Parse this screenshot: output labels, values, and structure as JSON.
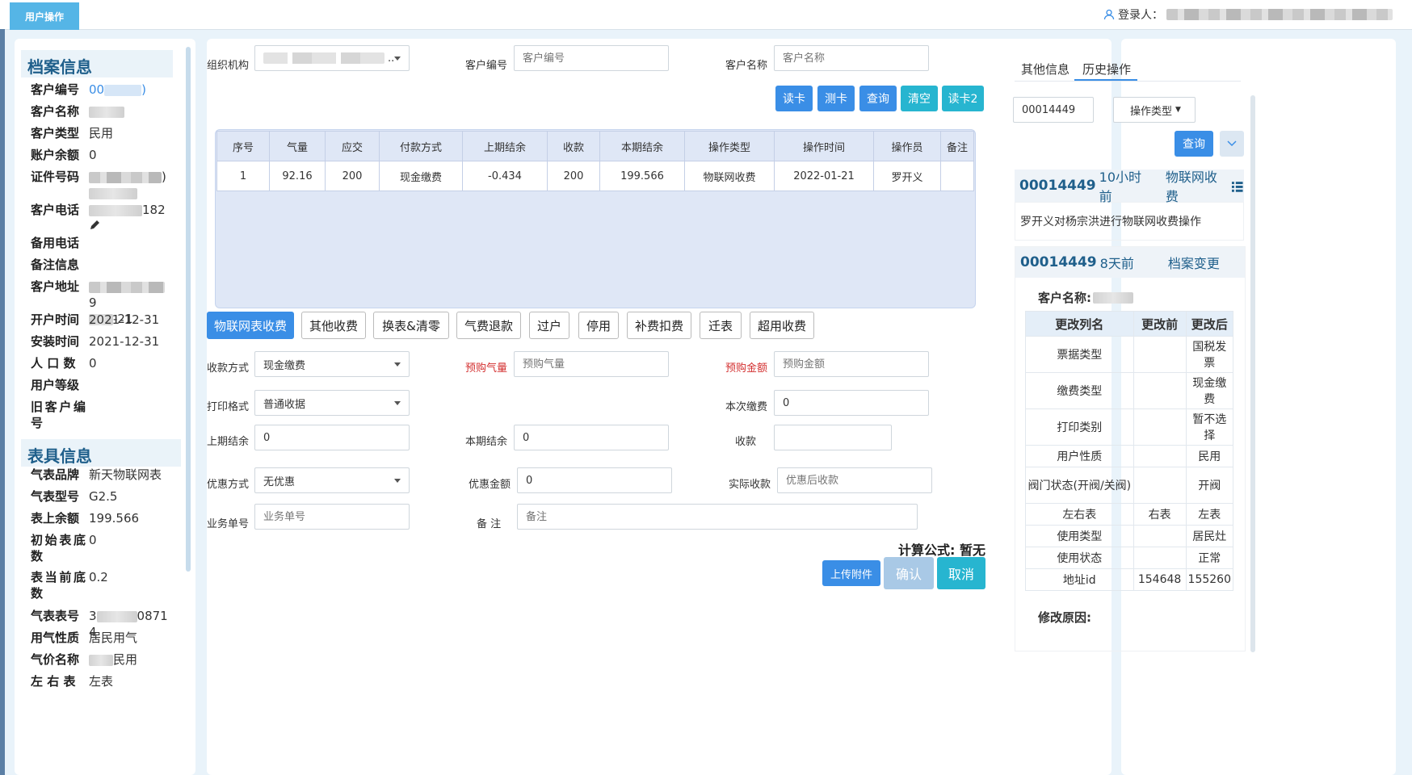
{
  "header": {
    "tab_label": "用户操作",
    "login_label": "登录人："
  },
  "archive": {
    "title": "档案信息",
    "customer_no_label": "客户编号",
    "customer_no_prefix": "00",
    "customer_no_suffix": ")",
    "customer_name_label": "客户名称",
    "customer_type_label": "客户类型",
    "customer_type": "民用",
    "balance_label": "账户余额",
    "balance": "0",
    "id_label": "证件号码",
    "id_suffix": ")",
    "phone_label": "客户电话",
    "phone_suffix": "182",
    "backup_phone_label": "备用电话",
    "remark_label": "备注信息",
    "address_label": "客户地址",
    "address_suffix": "9",
    "address_line2_suffix": "-21",
    "open_time_label": "开户时间",
    "open_time": "2021-12-31",
    "install_time_label": "安装时间",
    "install_time": "2021-12-31",
    "population_label": "人 口 数",
    "population": "0",
    "level_label": "用户等级",
    "old_no_label": "旧客户编号"
  },
  "meter": {
    "title": "表具信息",
    "brand_label": "气表品牌",
    "brand": "新天物联网表",
    "model_label": "气表型号",
    "model": "G2.5",
    "meter_balance_label": "表上余额",
    "meter_balance": "199.566",
    "init_reading_label": "初始表底数",
    "init_reading": "0",
    "current_reading_label": "表当前底数",
    "current_reading": "0.2",
    "meter_no_label": "气表表号",
    "meter_no_prefix": "3",
    "meter_no_suffix": "08714",
    "gas_nature_label": "用气性质",
    "gas_nature": "居民用气",
    "price_label": "气价名称",
    "price_suffix": "民用",
    "lr_label": "左 右 表",
    "lr": "左表"
  },
  "search": {
    "org_label": "组织机构",
    "cust_no_label": "客户编号",
    "cust_no_placeholder": "客户编号",
    "cust_name_label": "客户名称",
    "cust_name_placeholder": "客户名称",
    "buttons": [
      "读卡",
      "测卡",
      "查询",
      "清空",
      "读卡2"
    ]
  },
  "records": {
    "headers": [
      "序号",
      "气量",
      "应交",
      "付款方式",
      "上期结余",
      "收款",
      "本期结余",
      "操作类型",
      "操作时间",
      "操作员",
      "备注"
    ],
    "rows": [
      [
        "1",
        "92.16",
        "200",
        "现金缴费",
        "-0.434",
        "200",
        "199.566",
        "物联网收费",
        "2022-01-21",
        "罗开义",
        ""
      ]
    ]
  },
  "op_tabs": [
    "物联网表收费",
    "其他收费",
    "换表&清零",
    "气费退款",
    "过户",
    "停用",
    "补费扣费",
    "迁表",
    "超用收费"
  ],
  "form": {
    "pay_method_label": "收款方式",
    "pay_method": "现金缴费",
    "pre_gas_label": "预购气量",
    "pre_gas_placeholder": "预购气量",
    "pre_amount_label": "预购金额",
    "pre_amount_placeholder": "预购金额",
    "print_label": "打印格式",
    "print": "普通收据",
    "this_pay_label": "本次缴费",
    "this_pay": "0",
    "last_balance_label": "上期结余",
    "last_balance": "0",
    "cur_balance_label": "本期结余",
    "cur_balance": "0",
    "collect_label": "收款",
    "discount_label": "优惠方式",
    "discount": "无优惠",
    "discount_amount_label": "优惠金额",
    "discount_amount": "0",
    "actual_label": "实际收款",
    "actual_placeholder": "优惠后收款",
    "bizno_label": "业务单号",
    "bizno_placeholder": "业务单号",
    "note_label": "备 注",
    "note_placeholder": "备注",
    "formula": "计算公式: 暂无",
    "upload_btn": "上传附件",
    "confirm_btn": "确认",
    "cancel_btn": "取消"
  },
  "right": {
    "tabs": [
      "其他信息",
      "历史操作"
    ],
    "query_value": "00014449",
    "op_type_label": "操作类型",
    "query_btn": "查询",
    "hist1": {
      "id": "00014449",
      "time": "10小时前",
      "type": "物联网收费",
      "desc": "罗开义对杨宗洪进行物联网收费操作"
    },
    "hist2": {
      "id": "00014449",
      "time": "8天前",
      "type": "档案变更",
      "cust_label": "客户名称:"
    },
    "change_headers": [
      "更改列名",
      "更改前",
      "更改后"
    ],
    "changes": [
      [
        "票据类型",
        "",
        "国税发票"
      ],
      [
        "缴费类型",
        "",
        "现金缴费"
      ],
      [
        "打印类别",
        "",
        "暂不选择"
      ],
      [
        "用户性质",
        "",
        "民用"
      ],
      [
        "阀门状态(开阀/关阀)",
        "",
        "开阀"
      ],
      [
        "左右表",
        "右表",
        "左表"
      ],
      [
        "使用类型",
        "",
        "居民灶"
      ],
      [
        "使用状态",
        "",
        "正常"
      ],
      [
        "地址id",
        "154648",
        "155260"
      ]
    ],
    "reason_label": "修改原因:"
  }
}
